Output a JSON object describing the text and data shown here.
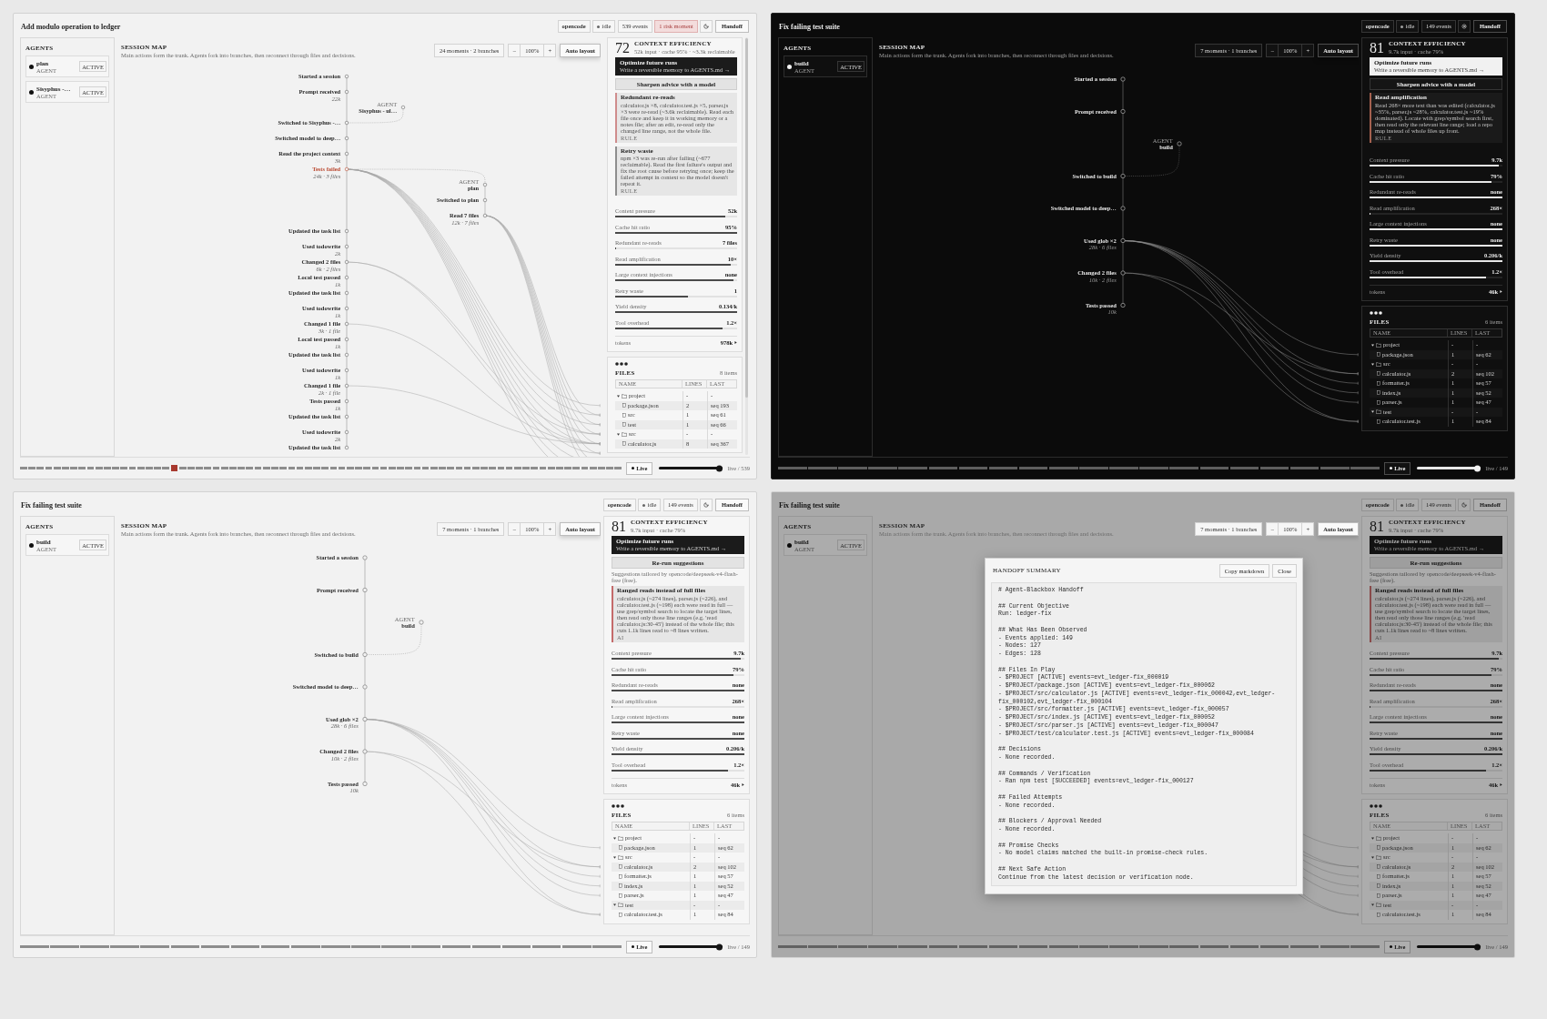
{
  "panels": [
    {
      "dark": false,
      "title": "Add modulo operation to ledger",
      "chips": [
        {
          "kind": "source",
          "text": "opencode"
        },
        {
          "kind": "status",
          "text": "idle"
        },
        {
          "kind": "count",
          "text": "539 events"
        },
        {
          "kind": "risk",
          "text": "1 risk moment"
        },
        {
          "kind": "moon"
        },
        {
          "kind": "action",
          "text": "Handoff"
        }
      ],
      "agents": {
        "heading": "AGENTS",
        "items": [
          {
            "name": "plan",
            "role": "AGENT",
            "status": "ACTIVE"
          },
          {
            "name": "Sisyphus -…",
            "role": "AGENT",
            "status": "ACTIVE"
          }
        ]
      },
      "map": {
        "heading": "SESSION MAP",
        "description": "Main actions form the trunk. Agents fork into branches, then reconnect through files and decisions.",
        "summary": "24 moments · 2 branches",
        "zoom_out": "–",
        "zoom": "100%",
        "zoom_in": "+",
        "auto_layout": "Auto layout",
        "moments": [
          {
            "kind": "event",
            "label": "Started a session",
            "risk": false
          },
          {
            "kind": "event",
            "label": "Prompt received",
            "detail": "22k",
            "risk": false
          },
          {
            "kind": "agent",
            "caption": "AGENT",
            "label": "Sisyphus - ul…"
          },
          {
            "kind": "event",
            "label": "Switched to Sisyphus -…",
            "risk": false
          },
          {
            "kind": "event",
            "label": "Switched model to deep…",
            "risk": false
          },
          {
            "kind": "event",
            "label": "Read the project context",
            "detail": "3k",
            "risk": false
          },
          {
            "kind": "event",
            "label": "Tests failed",
            "detail": "24k · 3 files",
            "risk": true
          },
          {
            "kind": "agent",
            "caption": "AGENT",
            "label": "plan",
            "children": [
              {
                "kind": "event",
                "label": "Switched to plan",
                "risk": false
              },
              {
                "kind": "event",
                "label": "Read 7 files",
                "detail": "12k · 7 files",
                "risk": false
              }
            ]
          },
          {
            "kind": "event",
            "label": "Updated the task list",
            "risk": false
          },
          {
            "kind": "event",
            "label": "Used todowrite",
            "detail": "2k",
            "risk": false
          },
          {
            "kind": "event",
            "label": "Changed 2 files",
            "detail": "6k · 2 files",
            "risk": false
          },
          {
            "kind": "event",
            "label": "Local test passed",
            "detail": "1k",
            "risk": false
          },
          {
            "kind": "event",
            "label": "Updated the task list",
            "risk": false
          },
          {
            "kind": "event",
            "label": "Used todowrite",
            "detail": "1k",
            "risk": false
          },
          {
            "kind": "event",
            "label": "Changed 1 file",
            "detail": "3k · 1 file",
            "risk": false
          },
          {
            "kind": "event",
            "label": "Local test passed",
            "detail": "1k",
            "risk": false
          },
          {
            "kind": "event",
            "label": "Updated the task list",
            "risk": false
          },
          {
            "kind": "event",
            "label": "Used todowrite",
            "detail": "1k",
            "risk": false
          },
          {
            "kind": "event",
            "label": "Changed 1 file",
            "detail": "2k · 1 file",
            "risk": false
          },
          {
            "kind": "event",
            "label": "Tests passed",
            "detail": "1k",
            "risk": false
          },
          {
            "kind": "event",
            "label": "Updated the task list",
            "risk": false
          },
          {
            "kind": "event",
            "label": "Used todowrite",
            "detail": "2k",
            "risk": false
          },
          {
            "kind": "event",
            "label": "Updated the task list",
            "risk": false
          }
        ]
      },
      "sidebar": {
        "scrollbar": true,
        "efficiency": {
          "score": "72",
          "heading": "CONTEXT EFFICIENCY",
          "summary": "52k input · cache 95% · ~3.3k reclaimable",
          "promo": {
            "title": "Optimize future runs",
            "subtitle": "Write a reversible memory to AGENTS.md →"
          },
          "action": "Sharpen advice with a model",
          "advice": [
            {
              "title": "Redundant re-reads",
              "text": "calculator.js ×8, calculator.test.js ×5, parser.js ×3 were re-read (~3.6k reclaimable). Read each file once and keep it in working memory or a notes file; after an edit, re-read only the changed line range, not the whole file.",
              "tag": "RULE",
              "color": "#cf8c8c"
            },
            {
              "title": "Retry waste",
              "text": "npm ×3 was re-run after failing (~677 reclaimable). Read the first failure's output and fix the root cause before retrying once; keep the failed attempt in context so the model doesn't repeat it.",
              "tag": "RULE",
              "color": "#8e8e8e"
            }
          ],
          "metrics": [
            {
              "label": "Context pressure",
              "value": "52k",
              "level": 0.9
            },
            {
              "label": "Cache hit ratio",
              "value": "95%",
              "level": 1
            },
            {
              "label": "Redundant re-reads",
              "value": "7 files",
              "level": 0
            },
            {
              "label": "Read amplification",
              "value": "10×",
              "level": 0.95
            },
            {
              "label": "Large context injections",
              "value": "none",
              "level": 0.97
            },
            {
              "label": "Retry waste",
              "value": "1",
              "level": 0.6
            },
            {
              "label": "Yield density",
              "value": "0.134/k",
              "level": 1
            },
            {
              "label": "Tool overhead",
              "value": "1.2×",
              "level": 0.88
            }
          ],
          "tokens": {
            "label": "tokens",
            "value": "978k"
          }
        },
        "files": {
          "heading": "FILES",
          "count": "8 items",
          "columns": [
            "NAME",
            "LINES",
            "LAST"
          ],
          "rows": [
            {
              "kind": "folder",
              "name": "project",
              "lines": "-",
              "last": "-",
              "expanded": true,
              "children": [
                {
                  "kind": "file",
                  "name": "package.json",
                  "lines": "2",
                  "last": "seq 193"
                },
                {
                  "kind": "file",
                  "name": "src",
                  "lines": "1",
                  "last": "seq 61"
                },
                {
                  "kind": "file",
                  "name": "test",
                  "lines": "1",
                  "last": "seq 66"
                }
              ]
            },
            {
              "kind": "folder",
              "name": "src",
              "lines": "-",
              "last": "-",
              "expanded": true,
              "children": [
                {
                  "kind": "file",
                  "name": "calculator.js",
                  "lines": "8",
                  "last": "seq 367"
                }
              ]
            }
          ]
        }
      },
      "timeline": {
        "segments": [
          {
            "risk": false
          },
          {
            "risk": false
          },
          {
            "risk": false
          },
          {
            "risk": false
          },
          {
            "risk": false
          },
          {
            "risk": false
          },
          {
            "risk": false
          },
          {
            "risk": false
          },
          {
            "risk": false
          },
          {
            "risk": false
          },
          {
            "risk": false
          },
          {
            "risk": false
          },
          {
            "risk": false
          },
          {
            "risk": false
          },
          {
            "risk": false
          },
          {
            "risk": false
          },
          {
            "risk": false
          },
          {
            "risk": false
          },
          {
            "risk": true
          },
          {
            "risk": false
          },
          {
            "risk": false
          },
          {
            "risk": false
          },
          {
            "risk": false
          },
          {
            "risk": false
          },
          {
            "risk": false
          },
          {
            "risk": false
          },
          {
            "risk": false
          },
          {
            "risk": false
          },
          {
            "risk": false
          },
          {
            "risk": false
          },
          {
            "risk": false
          },
          {
            "risk": false
          },
          {
            "risk": false
          },
          {
            "risk": false
          },
          {
            "risk": false
          },
          {
            "risk": false
          },
          {
            "risk": false
          },
          {
            "risk": false
          },
          {
            "risk": false
          },
          {
            "risk": false
          },
          {
            "risk": false
          },
          {
            "risk": false
          },
          {
            "risk": false
          },
          {
            "risk": false
          },
          {
            "risk": false
          },
          {
            "risk": false
          },
          {
            "risk": false
          },
          {
            "risk": false
          },
          {
            "risk": false
          },
          {
            "risk": false
          },
          {
            "risk": false
          },
          {
            "risk": false
          },
          {
            "risk": false
          },
          {
            "risk": false
          },
          {
            "risk": false
          },
          {
            "risk": false
          },
          {
            "risk": false
          },
          {
            "risk": false
          },
          {
            "risk": false
          },
          {
            "risk": false
          },
          {
            "risk": false
          },
          {
            "risk": false
          },
          {
            "risk": false
          },
          {
            "risk": false
          },
          {
            "risk": false
          },
          {
            "risk": false
          },
          {
            "risk": false
          },
          {
            "risk": false
          },
          {
            "risk": false
          },
          {
            "risk": false
          },
          {
            "risk": false
          },
          {
            "risk": false
          }
        ],
        "live": "Live",
        "level": 1,
        "position": "live / 539"
      }
    },
    {
      "dark": true,
      "title": "Fix failing test suite",
      "chips": [
        {
          "kind": "source",
          "text": "opencode"
        },
        {
          "kind": "status",
          "text": "idle"
        },
        {
          "kind": "count",
          "text": "149 events"
        },
        {
          "kind": "sun"
        },
        {
          "kind": "action",
          "text": "Handoff"
        }
      ],
      "agents": {
        "heading": "AGENTS",
        "items": [
          {
            "name": "build",
            "role": "AGENT",
            "status": "ACTIVE"
          }
        ]
      },
      "map": {
        "heading": "SESSION MAP",
        "description": "Main actions form the trunk. Agents fork into branches, then reconnect through files and decisions.",
        "summary": "7 moments · 1 branches",
        "zoom_out": "–",
        "zoom": "100%",
        "zoom_in": "+",
        "auto_layout": "Auto layout",
        "moments": [
          {
            "kind": "event",
            "label": "Started a session",
            "risk": false
          },
          {
            "kind": "event",
            "label": "Prompt received",
            "risk": false
          },
          {
            "kind": "agent",
            "caption": "AGENT",
            "label": "build"
          },
          {
            "kind": "event",
            "label": "Switched to build",
            "risk": false
          },
          {
            "kind": "event",
            "label": "Switched model to deep…",
            "risk": false
          },
          {
            "kind": "event",
            "label": "Used glob ×2",
            "detail": "28k · 6 files",
            "risk": false
          },
          {
            "kind": "event",
            "label": "Changed 2 files",
            "detail": "10k · 2 files",
            "risk": false
          },
          {
            "kind": "event",
            "label": "Tests passed",
            "detail": "10k",
            "risk": false
          }
        ]
      },
      "sidebar": {
        "efficiency": {
          "score": "81",
          "heading": "CONTEXT EFFICIENCY",
          "summary": "9.7k input · cache 79%",
          "promo": {
            "title": "Optimize future runs",
            "subtitle": "Write a reversible memory to AGENTS.md →"
          },
          "action": "Sharpen advice with a model",
          "advice": [
            {
              "title": "Read amplification",
              "text": "Read 268× more text than was edited (calculator.js ~35%, parser.js ~28%, calculator.test.js ~19% dominated). Locate with grep/symbol search first, then read only the relevant line range; load a repo map instead of whole files up front.",
              "tag": "RULE",
              "color": "#a5614f"
            }
          ],
          "metrics": [
            {
              "label": "Context pressure",
              "value": "9.7k",
              "level": 0.97
            },
            {
              "label": "Cache hit ratio",
              "value": "79%",
              "level": 0.92
            },
            {
              "label": "Redundant re-reads",
              "value": "none",
              "level": 1
            },
            {
              "label": "Read amplification",
              "value": "268×",
              "level": 0
            },
            {
              "label": "Large context injections",
              "value": "none",
              "level": 1
            },
            {
              "label": "Retry waste",
              "value": "none",
              "level": 1
            },
            {
              "label": "Yield density",
              "value": "0.206/k",
              "level": 1
            },
            {
              "label": "Tool overhead",
              "value": "1.2×",
              "level": 0.88
            }
          ],
          "tokens": {
            "label": "tokens",
            "value": "46k"
          }
        },
        "files": {
          "heading": "FILES",
          "count": "6 items",
          "columns": [
            "NAME",
            "LINES",
            "LAST"
          ],
          "rows": [
            {
              "kind": "folder",
              "name": "project",
              "lines": "-",
              "last": "-",
              "expanded": true,
              "children": [
                {
                  "kind": "file",
                  "name": "package.json",
                  "lines": "1",
                  "last": "seq 62"
                }
              ]
            },
            {
              "kind": "folder",
              "name": "src",
              "lines": "-",
              "last": "-",
              "expanded": true,
              "children": [
                {
                  "kind": "file",
                  "name": "calculator.js",
                  "lines": "2",
                  "last": "seq 102"
                },
                {
                  "kind": "file",
                  "name": "formatter.js",
                  "lines": "1",
                  "last": "seq 57"
                },
                {
                  "kind": "file",
                  "name": "index.js",
                  "lines": "1",
                  "last": "seq 52"
                },
                {
                  "kind": "file",
                  "name": "parser.js",
                  "lines": "1",
                  "last": "seq 47"
                }
              ]
            },
            {
              "kind": "folder",
              "name": "test",
              "lines": "-",
              "last": "-",
              "expanded": true,
              "children": [
                {
                  "kind": "file",
                  "name": "calculator.test.js",
                  "lines": "1",
                  "last": "seq 84"
                }
              ]
            }
          ]
        }
      },
      "timeline": {
        "segments": [
          {
            "risk": false
          },
          {
            "risk": false
          },
          {
            "risk": false
          },
          {
            "risk": false
          },
          {
            "risk": false
          },
          {
            "risk": false
          },
          {
            "risk": false
          },
          {
            "risk": false
          },
          {
            "risk": false
          },
          {
            "risk": false
          },
          {
            "risk": false
          },
          {
            "risk": false
          },
          {
            "risk": false
          },
          {
            "risk": false
          },
          {
            "risk": false
          },
          {
            "risk": false
          },
          {
            "risk": false
          },
          {
            "risk": false
          },
          {
            "risk": false
          },
          {
            "risk": false
          }
        ],
        "live": "Live",
        "level": 1,
        "position": "live / 149"
      }
    },
    {
      "dark": false,
      "title": "Fix failing test suite",
      "chips": [
        {
          "kind": "source",
          "text": "opencode"
        },
        {
          "kind": "status",
          "text": "idle"
        },
        {
          "kind": "count",
          "text": "149 events"
        },
        {
          "kind": "moon"
        },
        {
          "kind": "action",
          "text": "Handoff"
        }
      ],
      "agents": {
        "heading": "AGENTS",
        "items": [
          {
            "name": "build",
            "role": "AGENT",
            "status": "ACTIVE"
          }
        ]
      },
      "map": {
        "heading": "SESSION MAP",
        "description": "Main actions form the trunk. Agents fork into branches, then reconnect through files and decisions.",
        "summary": "7 moments · 1 branches",
        "zoom_out": "–",
        "zoom": "100%",
        "zoom_in": "+",
        "auto_layout": "Auto layout",
        "moments": [
          {
            "kind": "event",
            "label": "Started a session",
            "risk": false
          },
          {
            "kind": "event",
            "label": "Prompt received",
            "risk": false
          },
          {
            "kind": "agent",
            "caption": "AGENT",
            "label": "build"
          },
          {
            "kind": "event",
            "label": "Switched to build",
            "risk": false
          },
          {
            "kind": "event",
            "label": "Switched model to deep…",
            "risk": false
          },
          {
            "kind": "event",
            "label": "Used glob ×2",
            "detail": "28k · 6 files",
            "risk": false
          },
          {
            "kind": "event",
            "label": "Changed 2 files",
            "detail": "10k · 2 files",
            "risk": false
          },
          {
            "kind": "event",
            "label": "Tests passed",
            "detail": "10k",
            "risk": false
          }
        ]
      },
      "sidebar": {
        "efficiency": {
          "score": "81",
          "heading": "CONTEXT EFFICIENCY",
          "summary": "9.7k input · cache 79%",
          "promo": {
            "title": "Optimize future runs",
            "subtitle": "Write a reversible memory to AGENTS.md →"
          },
          "action": "Re-run suggestions",
          "note": "Suggestions tailored by opencode/deepseek-v4-flash-free (free).",
          "advice": [
            {
              "title": "Ranged reads instead of full files",
              "text": "calculator.js (~274 lines), parser.js (~226), and calculator.test.js (~198) each were read in full — use grep/symbol search to locate the target lines, then read only those line ranges (e.g. 'read calculator.js:30-45') instead of the whole file; this cuts 1.1k lines read to ~8 lines written.",
              "tag": "AI",
              "color": "#c46a6a"
            }
          ],
          "metrics": [
            {
              "label": "Context pressure",
              "value": "9.7k",
              "level": 0.97
            },
            {
              "label": "Cache hit ratio",
              "value": "79%",
              "level": 0.92
            },
            {
              "label": "Redundant re-reads",
              "value": "none",
              "level": 1
            },
            {
              "label": "Read amplification",
              "value": "268×",
              "level": 0
            },
            {
              "label": "Large context injections",
              "value": "none",
              "level": 1
            },
            {
              "label": "Retry waste",
              "value": "none",
              "level": 1
            },
            {
              "label": "Yield density",
              "value": "0.206/k",
              "level": 1
            },
            {
              "label": "Tool overhead",
              "value": "1.2×",
              "level": 0.88
            }
          ],
          "tokens": {
            "label": "tokens",
            "value": "46k"
          }
        },
        "files": {
          "heading": "FILES",
          "count": "6 items",
          "columns": [
            "NAME",
            "LINES",
            "LAST"
          ],
          "rows": [
            {
              "kind": "folder",
              "name": "project",
              "lines": "-",
              "last": "-",
              "expanded": true,
              "children": [
                {
                  "kind": "file",
                  "name": "package.json",
                  "lines": "1",
                  "last": "seq 62"
                }
              ]
            },
            {
              "kind": "folder",
              "name": "src",
              "lines": "-",
              "last": "-",
              "expanded": true,
              "children": [
                {
                  "kind": "file",
                  "name": "calculator.js",
                  "lines": "2",
                  "last": "seq 102"
                },
                {
                  "kind": "file",
                  "name": "formatter.js",
                  "lines": "1",
                  "last": "seq 57"
                },
                {
                  "kind": "file",
                  "name": "index.js",
                  "lines": "1",
                  "last": "seq 52"
                },
                {
                  "kind": "file",
                  "name": "parser.js",
                  "lines": "1",
                  "last": "seq 47"
                }
              ]
            },
            {
              "kind": "folder",
              "name": "test",
              "lines": "-",
              "last": "-",
              "expanded": true,
              "children": [
                {
                  "kind": "file",
                  "name": "calculator.test.js",
                  "lines": "1",
                  "last": "seq 84"
                }
              ]
            }
          ]
        }
      },
      "timeline": {
        "segments": [
          {
            "risk": false
          },
          {
            "risk": false
          },
          {
            "risk": false
          },
          {
            "risk": false
          },
          {
            "risk": false
          },
          {
            "risk": false
          },
          {
            "risk": false
          },
          {
            "risk": false
          },
          {
            "risk": false
          },
          {
            "risk": false
          },
          {
            "risk": false
          },
          {
            "risk": false
          },
          {
            "risk": false
          },
          {
            "risk": false
          },
          {
            "risk": false
          },
          {
            "risk": false
          },
          {
            "risk": false
          },
          {
            "risk": false
          },
          {
            "risk": false
          },
          {
            "risk": false
          }
        ],
        "live": "Live",
        "level": 1,
        "position": "live / 149"
      }
    },
    {
      "dark": false,
      "title": "Fix failing test suite",
      "chips": [
        {
          "kind": "source",
          "text": "opencode"
        },
        {
          "kind": "status",
          "text": "idle"
        },
        {
          "kind": "count",
          "text": "149 events"
        },
        {
          "kind": "moon"
        },
        {
          "kind": "action",
          "text": "Handoff"
        }
      ],
      "agents": {
        "heading": "AGENTS",
        "items": [
          {
            "name": "build",
            "role": "AGENT",
            "status": "ACTIVE"
          }
        ]
      },
      "map": {
        "heading": "SESSION MAP",
        "description": "Main actions form the trunk. Agents fork into branches, then reconnect through files and decisions.",
        "summary": "7 moments · 1 branches",
        "zoom_out": "–",
        "zoom": "100%",
        "zoom_in": "+",
        "auto_layout": "Auto layout"
      },
      "sidebar": {
        "efficiency": {
          "score": "81",
          "heading": "CONTEXT EFFICIENCY",
          "summary": "9.7k input · cache 79%",
          "promo": {
            "title": "Optimize future runs",
            "subtitle": "Write a reversible memory to AGENTS.md →"
          },
          "action": "Re-run suggestions",
          "note": "Suggestions tailored by opencode/deepseek-v4-flash-free (free).",
          "advice": [
            {
              "title": "Ranged reads instead of full files",
              "text": "calculator.js (~274 lines), parser.js (~226), and calculator.test.js (~198) each were read in full — use grep/symbol search to locate the target lines, then read only those line ranges (e.g. 'read calculator.js:30-45') instead of the whole file; this cuts 1.1k lines read to ~8 lines written.",
              "tag": "AI",
              "color": "#894a4a"
            }
          ],
          "metrics": [
            {
              "label": "Context pressure",
              "value": "9.7k",
              "level": 0.97
            },
            {
              "label": "Cache hit ratio",
              "value": "79%",
              "level": 0.92
            },
            {
              "label": "Redundant re-reads",
              "value": "none",
              "level": 1
            },
            {
              "label": "Read amplification",
              "value": "268×",
              "level": 0
            },
            {
              "label": "Large context injections",
              "value": "none",
              "level": 1
            },
            {
              "label": "Retry waste",
              "value": "none",
              "level": 1
            },
            {
              "label": "Yield density",
              "value": "0.206/k",
              "level": 1
            },
            {
              "label": "Tool overhead",
              "value": "1.2×",
              "level": 0.88
            }
          ],
          "tokens": {
            "label": "tokens",
            "value": "46k"
          }
        },
        "files": {
          "heading": "FILES",
          "count": "6 items",
          "columns": [
            "NAME",
            "LINES",
            "LAST"
          ],
          "rows": [
            {
              "kind": "folder",
              "name": "project",
              "lines": "-",
              "last": "-",
              "expanded": true,
              "children": [
                {
                  "kind": "file",
                  "name": "package.json",
                  "lines": "1",
                  "last": "seq 62"
                }
              ]
            },
            {
              "kind": "folder",
              "name": "src",
              "lines": "-",
              "last": "-",
              "expanded": true,
              "children": [
                {
                  "kind": "file",
                  "name": "calculator.js",
                  "lines": "2",
                  "last": "seq 102"
                },
                {
                  "kind": "file",
                  "name": "formatter.js",
                  "lines": "1",
                  "last": "seq 57"
                },
                {
                  "kind": "file",
                  "name": "index.js",
                  "lines": "1",
                  "last": "seq 52"
                },
                {
                  "kind": "file",
                  "name": "parser.js",
                  "lines": "1",
                  "last": "seq 47"
                }
              ]
            },
            {
              "kind": "folder",
              "name": "test",
              "lines": "-",
              "last": "-",
              "expanded": true,
              "children": [
                {
                  "kind": "file",
                  "name": "calculator.test.js",
                  "lines": "1",
                  "last": "seq 84"
                }
              ]
            }
          ]
        }
      },
      "timeline": {
        "segments": [
          {
            "risk": false
          },
          {
            "risk": false
          },
          {
            "risk": false
          },
          {
            "risk": false
          },
          {
            "risk": false
          },
          {
            "risk": false
          },
          {
            "risk": false
          },
          {
            "risk": false
          },
          {
            "risk": false
          },
          {
            "risk": false
          },
          {
            "risk": false
          },
          {
            "risk": false
          },
          {
            "risk": false
          },
          {
            "risk": false
          },
          {
            "risk": false
          },
          {
            "risk": false
          },
          {
            "risk": false
          },
          {
            "risk": false
          },
          {
            "risk": false
          },
          {
            "risk": false
          }
        ],
        "live": "Live",
        "level": 1,
        "position": "live / 149"
      },
      "modal": {
        "title": "HANDOFF SUMMARY",
        "actions": [
          "Copy markdown",
          "Close"
        ],
        "markdown": "# Agent-Blackbox Handoff\n\n## Current Objective\nRun: ledger-fix\n\n## What Has Been Observed\n- Events applied: 149\n- Nodes: 127\n- Edges: 128\n\n## Files In Play\n- $PROJECT [ACTIVE] events=evt_ledger-fix_000019\n- $PROJECT/package.json [ACTIVE] events=evt_ledger-fix_000062\n- $PROJECT/src/calculator.js [ACTIVE] events=evt_ledger-fix_000042,evt_ledger-fix_000102,evt_ledger-fix_000104\n- $PROJECT/src/formatter.js [ACTIVE] events=evt_ledger-fix_000057\n- $PROJECT/src/index.js [ACTIVE] events=evt_ledger-fix_000052\n- $PROJECT/src/parser.js [ACTIVE] events=evt_ledger-fix_000047\n- $PROJECT/test/calculator.test.js [ACTIVE] events=evt_ledger-fix_000084\n\n## Decisions\n- None recorded.\n\n## Commands / Verification\n- Ran npm test [SUCCEEDED] events=evt_ledger-fix_000127\n\n## Failed Attempts\n- None recorded.\n\n## Blockers / Approval Needed\n- None recorded.\n\n## Promise Checks\n- No model claims matched the built-in promise-check rules.\n\n## Next Safe Action\nContinue from the latest decision or verification node."
      }
    }
  ]
}
